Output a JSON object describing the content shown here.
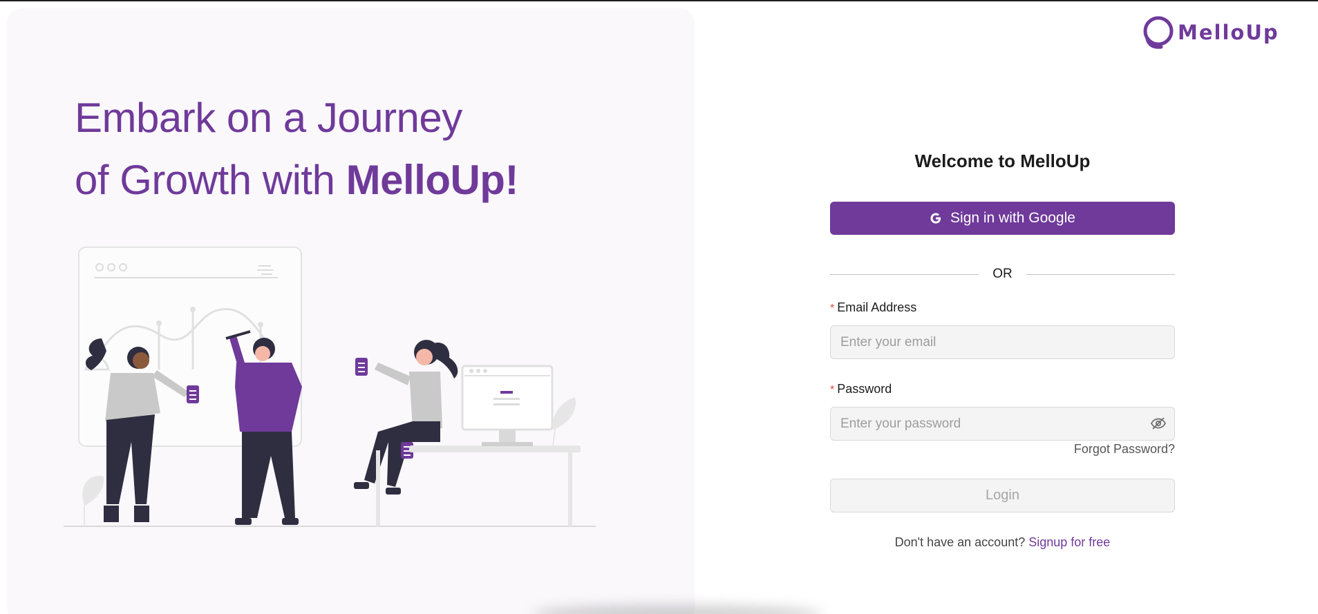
{
  "brand": {
    "name": "MelloUp",
    "color": "#6f3a9a"
  },
  "hero": {
    "line1": "Embark on a Journey",
    "line2_prefix": "of Growth with ",
    "line2_brand": "MelloUp!"
  },
  "auth": {
    "welcome": "Welcome to MelloUp",
    "google_button": "Sign in with Google",
    "divider": "OR",
    "email": {
      "label": "Email Address",
      "required_mark": "*",
      "placeholder": "Enter your email",
      "value": ""
    },
    "password": {
      "label": "Password",
      "required_mark": "*",
      "placeholder": "Enter your password",
      "value": "",
      "visibility_icon": "eye-off-icon"
    },
    "forgot": "Forgot Password?",
    "login_button": "Login",
    "signup_prompt": "Don't have an account?",
    "signup_link": "Signup for free"
  },
  "colors": {
    "accent": "#6f3a9a",
    "required": "#e5483d",
    "panel_bg": "#faf8fb"
  }
}
